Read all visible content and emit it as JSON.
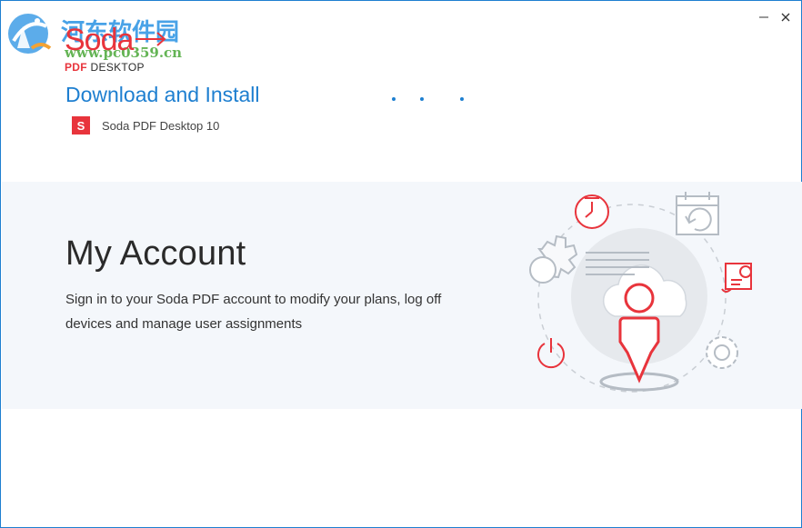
{
  "window": {
    "minimize_symbol": "—",
    "close_symbol": "✕"
  },
  "watermark": {
    "title": "河东软件园",
    "url": "www.pc0359.cn"
  },
  "brand": {
    "name": "Soda",
    "sub_pdf": "PDF",
    "sub_desktop": "DESKTOP",
    "accent": "#e8343c"
  },
  "install": {
    "title": "Download and Install",
    "product_icon_letter": "S",
    "product_name": "Soda PDF Desktop 10",
    "accent": "#1e7fd0"
  },
  "account": {
    "title": "My Account",
    "description": "Sign in to your Soda PDF account to modify your plans, log off devices and manage user assignments"
  },
  "illustration_icons": [
    "clock-icon",
    "calendar-refresh-icon",
    "certificate-icon",
    "gear-icon",
    "power-icon",
    "user-icon",
    "cloud-icon"
  ]
}
